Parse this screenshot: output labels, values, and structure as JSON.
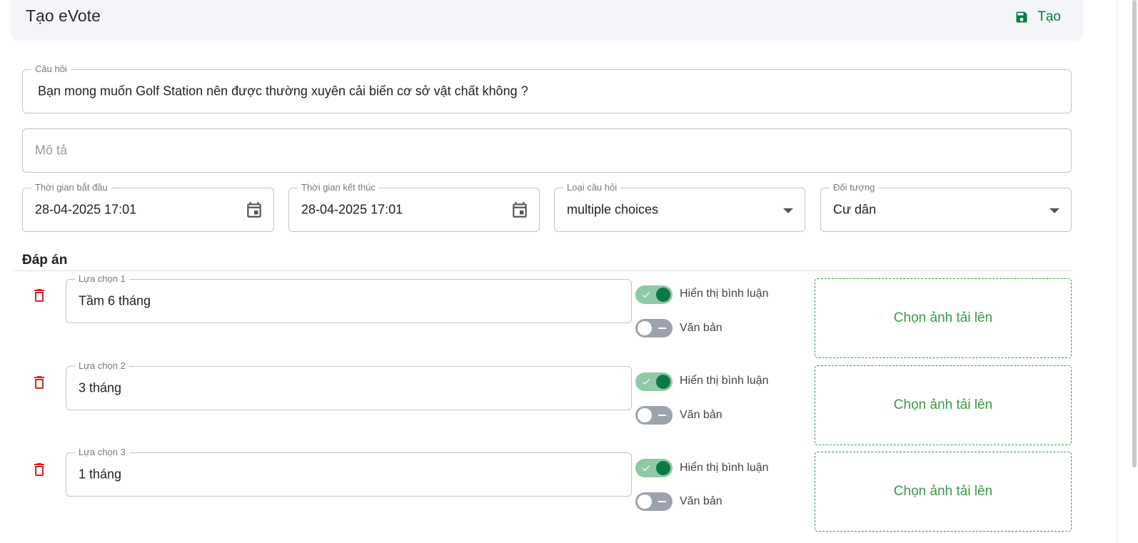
{
  "header": {
    "title": "Tạo eVote",
    "create_label": "Tạo"
  },
  "form": {
    "question": {
      "label": "Câu hỏi",
      "value": "Bạn mong muốn Golf Station nên được thường xuyên cải biến cơ sở vật chất không ?"
    },
    "description": {
      "placeholder": "Mô tả"
    },
    "start_time": {
      "label": "Thời gian bắt đầu",
      "value": "28-04-2025 17:01"
    },
    "end_time": {
      "label": "Thời gian kết thúc",
      "value": "28-04-2025 17:01"
    },
    "question_type": {
      "label": "Loại câu hỏi",
      "value": "multiple choices"
    },
    "audience": {
      "label": "Đối tượng",
      "value": "Cư dân"
    }
  },
  "answers": {
    "title": "Đáp án",
    "items": [
      {
        "label": "Lựa chọn 1",
        "value": "Tầm 6 tháng",
        "show_comment_label": "Hiển thị bình luận",
        "show_comment": true,
        "text_label": "Văn bản",
        "text": false,
        "upload_label": "Chọn ảnh tải lên"
      },
      {
        "label": "Lựa chọn 2",
        "value": "3 tháng",
        "show_comment_label": "Hiển thị bình luận",
        "show_comment": true,
        "text_label": "Văn bản",
        "text": false,
        "upload_label": "Chọn ảnh tải lên"
      },
      {
        "label": "Lựa chọn 3",
        "value": "1 tháng",
        "show_comment_label": "Hiển thị bình luận",
        "show_comment": true,
        "text_label": "Văn bản",
        "text": false,
        "upload_label": "Chọn ảnh tải lên"
      }
    ]
  },
  "colors": {
    "accent": "#0a7a45",
    "toggle_on_track": "#8fc9a7",
    "toggle_off_track": "#9da3ad",
    "upload": "#3a9a4a",
    "danger": "#e02020"
  },
  "icons": {
    "save": "floppy-disk-icon",
    "calendar": "calendar-icon",
    "dropdown": "caret-down-icon",
    "delete": "trash-icon"
  }
}
